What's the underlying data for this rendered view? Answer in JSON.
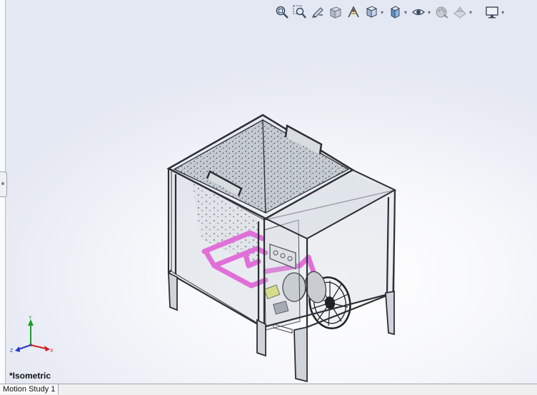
{
  "view": {
    "orientation_label": "*Isometric"
  },
  "hud_toolbar": {
    "buttons": [
      {
        "icon": "zoom-to-fit-icon"
      },
      {
        "icon": "zoom-to-area-icon"
      },
      {
        "icon": "previous-view-icon"
      },
      {
        "icon": "section-view-icon"
      },
      {
        "icon": "dynamic-annotation-icon"
      },
      {
        "icon": "view-orientation-icon",
        "dropdown": true
      },
      {
        "icon": "display-style-icon",
        "dropdown": true
      },
      {
        "icon": "hide-show-items-icon",
        "dropdown": true
      },
      {
        "icon": "edit-appearance-icon"
      },
      {
        "icon": "apply-scene-icon",
        "dropdown": true
      },
      {
        "icon": "view-settings-icon",
        "dropdown": true
      }
    ],
    "dropdown_glyph": "▾"
  },
  "triad": {
    "y_label": "Y",
    "z_label": "Z",
    "x_label": "X",
    "colors": {
      "x": "#d12020",
      "y": "#1e9b2c",
      "z": "#2439c8"
    }
  },
  "bottom_tabs": [
    {
      "label": "Motion Study 1"
    }
  ],
  "colors": {
    "frame": "#3d4249",
    "glass": "#b9c2cc",
    "pipe": "#e070d8",
    "fan": "#2a2d33",
    "accent_yellow": "#d8e070"
  }
}
